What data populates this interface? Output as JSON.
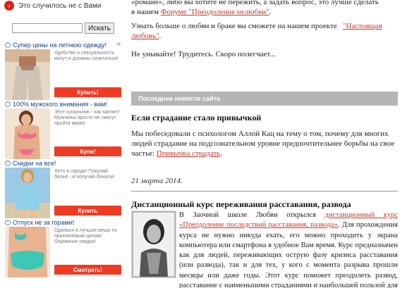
{
  "top_link": {
    "label": "Это случилось не с Вами"
  },
  "search": {
    "placeholder": "",
    "button_label": "Искать"
  },
  "ads": [
    {
      "title": "Супер цены на летнюю одежду!",
      "text": "Удобство и сексуальность могут и должны сочетаться!",
      "button": "Купить!"
    },
    {
      "title": "100% мужского внимания - вам!",
      "text": "Этот купальник - как магнит! Мужчины просто не смогут пройти мимо!",
      "button": "Купи!"
    },
    {
      "title": "Скидки на все!",
      "text": "Лето в городе! Покупай бельё - и получай бонусы!",
      "button": "Купить"
    },
    {
      "title": "Отпуск не за горами!",
      "text": "Оденься в лучшие вещи по приемлемым ценам! Огромные скидки!",
      "button": "Смотреть!"
    }
  ],
  "main": {
    "intro_line": "«романе», либо вы хотите не пережить, а задать вопрос, это лучше сделать",
    "forum_prefix": "в нашем",
    "forum_link": "Форуме \"Преодоление нелюбви\"",
    "forum_suffix": ".",
    "project_text": "Узнать больше о любви и браке вы сможете на нашем проекте",
    "project_link": "\"Настоящая любовь\"",
    "project_suffix": ".",
    "encourage": "Не унывайте! Трудитесь. Скоро полегчает...",
    "news_bar": "Последние новости сайта",
    "article1_title": "Если страдание стало привычкой",
    "article1_text": "Мы побеседовали с психологом Аллой Кац на тему о том, почему для многих людей страдание на подсознательном уровне предпочтительнее борьбы на свое частье:",
    "article1_link": "Привычка страдать",
    "article1_suffix": ".",
    "article1_date": "21 марта 2014.",
    "article2_title": "Дистанционный курс переживания расставания, развода",
    "article2_lead": "В Заочной школе Любви открылся",
    "article2_link": "дистанционный курс «Преодоление последствий расставания, развода»",
    "article2_text": ". Для прохождения курса не нужно никуда ехать, его можно проходить у экрана компьютера или смартфона в удобное Вам время. Курс предназначен как для людей, переживающих острую фазу кризиса расставания (или развода), так и для тех, у кого с момента разрыва прошли месяцы или даже годы. Этот курс поможет преодолеть развод, расставание с наименьшими страданиями и наибольшей пользой для Вашей дальнейшей личной жизни. Курс интенсивный — его"
  },
  "colors": {
    "link": "#c0392b",
    "green_link": "#2e7d32",
    "button": "#ef3b24",
    "news_bar": "#b5b5b5"
  }
}
